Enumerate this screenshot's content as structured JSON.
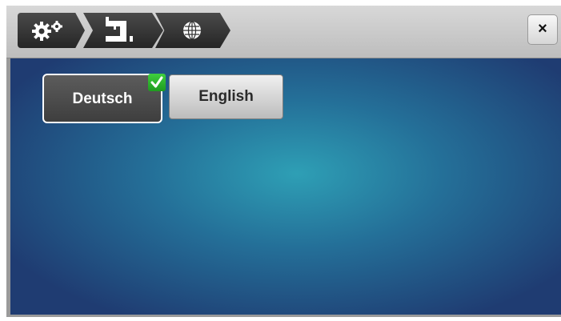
{
  "toolbar": {
    "breadcrumbs": [
      {
        "icon": "settings-gears-icon"
      },
      {
        "icon": "machine-icon"
      },
      {
        "icon": "globe-icon"
      }
    ],
    "close_label": "×"
  },
  "languages": {
    "options": [
      {
        "label": "Deutsch",
        "selected": true
      },
      {
        "label": "English",
        "selected": false
      }
    ]
  },
  "colors": {
    "selected_check": "#2dbb2d",
    "background_center": "#2e9fb5",
    "background_edge": "#1f3c72"
  }
}
